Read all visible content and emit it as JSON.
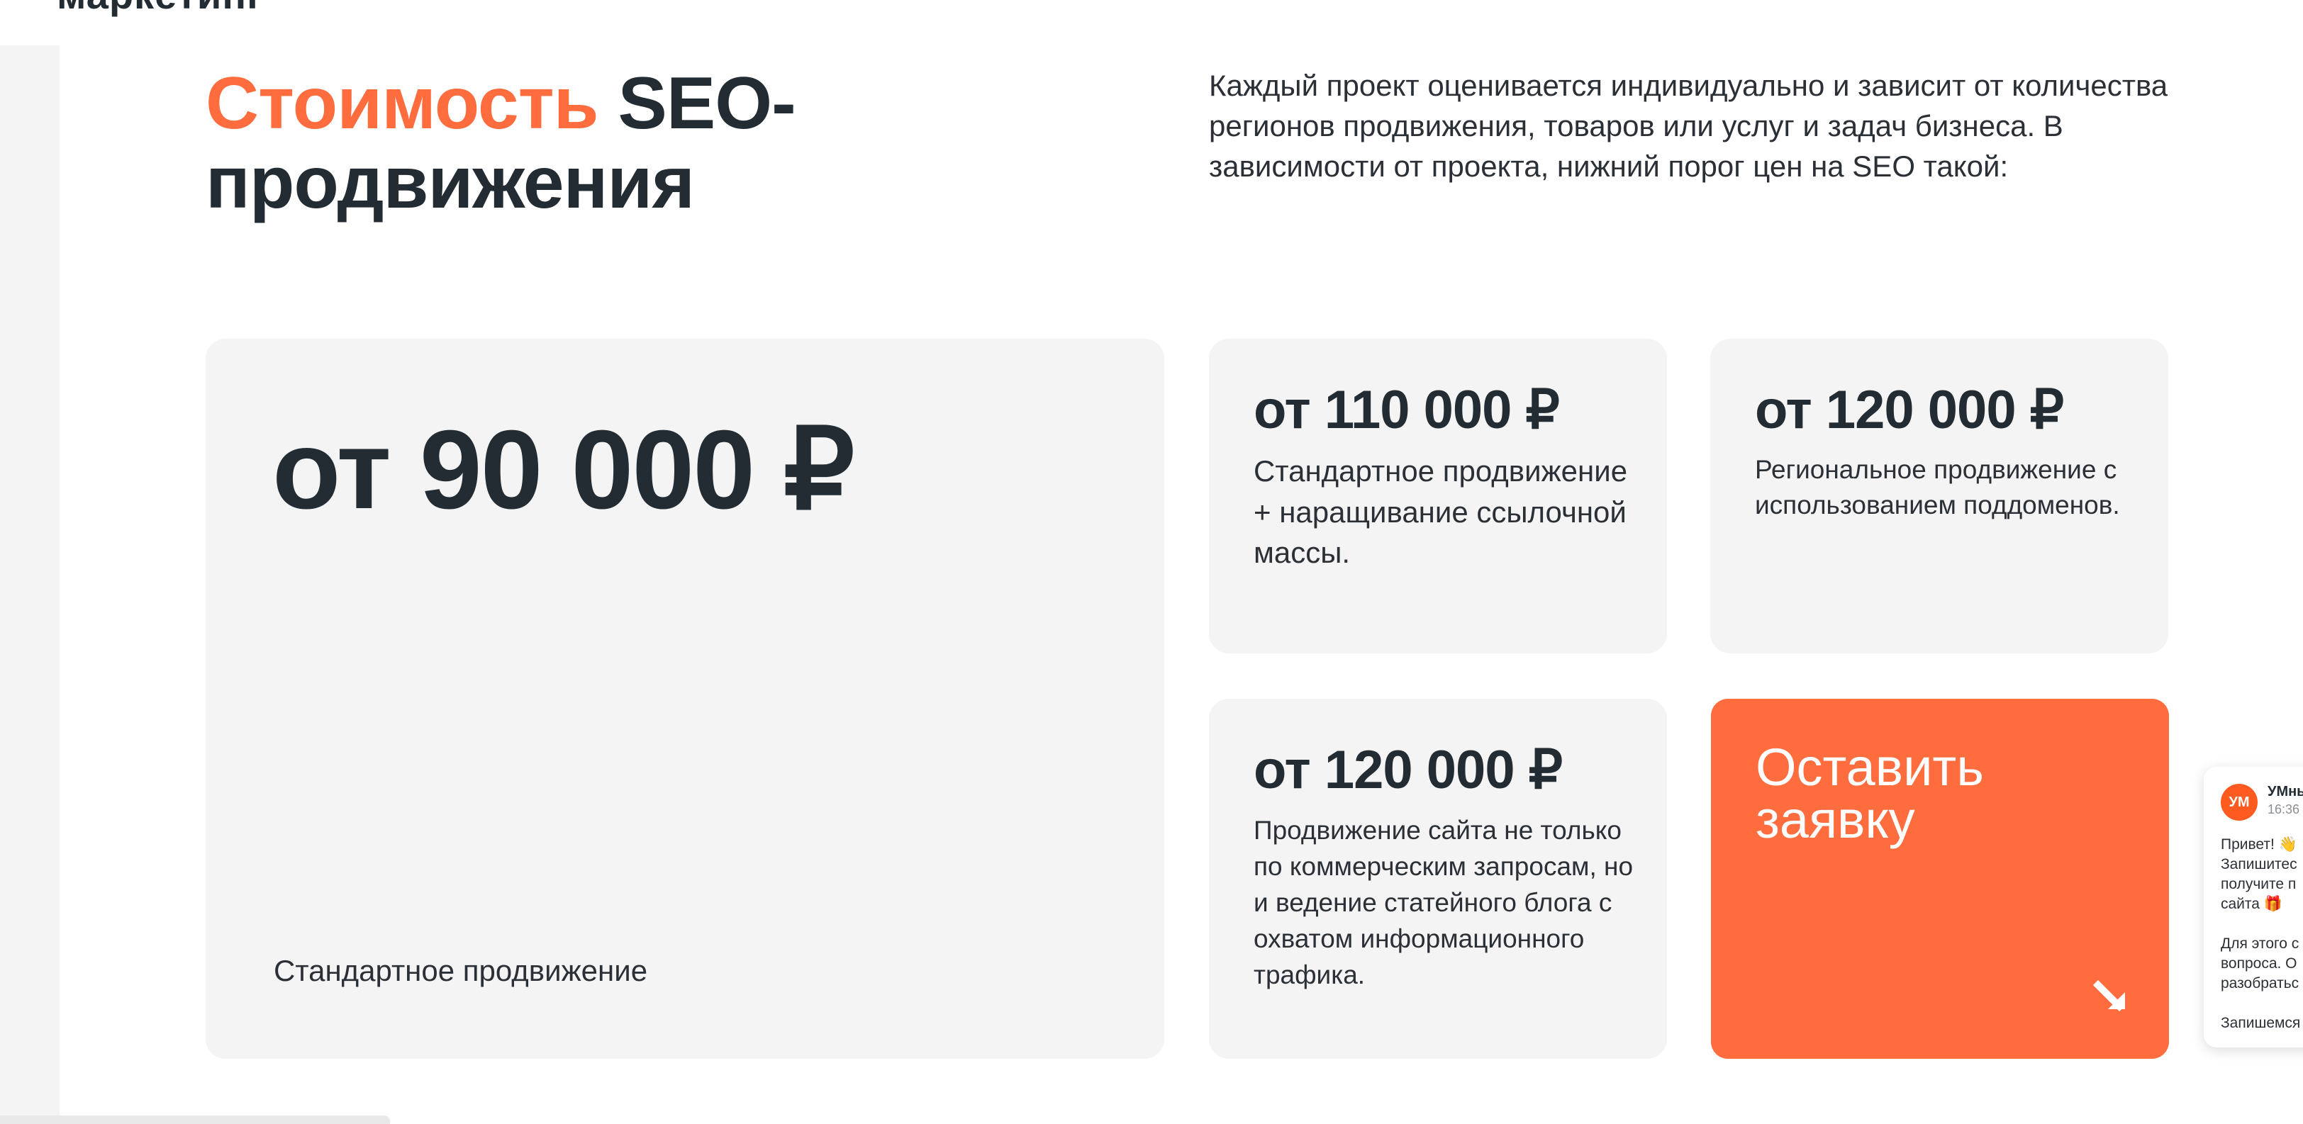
{
  "header": {
    "brand_cut": "маркетинг"
  },
  "hero": {
    "title_accent": "Стоимость",
    "title_rest_line1": " SEO-",
    "title_line2": "продвижения",
    "intro": "Каждый проект оценивается индивидуально и зависит от количества регионов продвижения, товаров или услуг и задач бизнеса. В зависимости от проекта, нижний порог цен на SEO такой:"
  },
  "pricing": {
    "main": {
      "price": "от 90 000 ₽",
      "desc": "Стандартное продвижение"
    },
    "cards": [
      {
        "price": "от 110 000 ₽",
        "desc": "Стандартное продвижение + наращивание ссылочной массы."
      },
      {
        "price": "от 120 000 ₽",
        "desc": "Региональное продвижение с использованием поддоменов."
      },
      {
        "price": "от 120 000 ₽",
        "desc": "Продвижение сайта не только по коммерческим запросам, но и ведение статейного блога с охватом информационного трафика."
      }
    ],
    "cta": {
      "label": "Оставить заявку",
      "icon": "arrow-down-right-icon"
    }
  },
  "chat_widget": {
    "avatar": "УМ",
    "name": "УМны",
    "time": "16:36",
    "message": "Привет! 👋\nЗапишитес\nполучите п\nсайта 🎁\n\nДля этого с\nвопроса. О\nразобратьс\n\nЗапишемся"
  },
  "colors": {
    "accent": "#ff6c3e",
    "text": "#232b33",
    "card_bg": "#f4f4f4"
  }
}
